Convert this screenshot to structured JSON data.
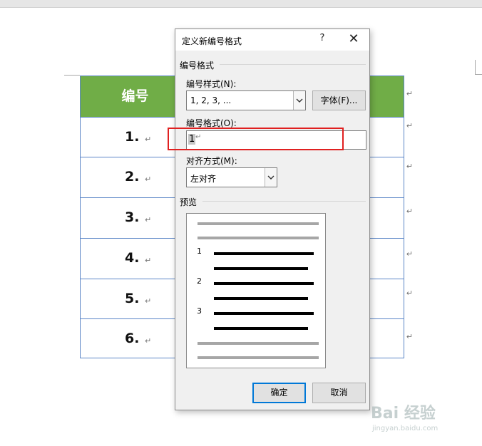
{
  "document": {
    "table_header": "编号",
    "rows": [
      "1.",
      "2.",
      "3.",
      "4.",
      "5.",
      "6."
    ],
    "paragraph_mark": "↵"
  },
  "dialog": {
    "title": "定义新编号格式",
    "help_label": "?",
    "close_label": "✕",
    "section_number_format": "编号格式",
    "number_style_label": "编号样式(N):",
    "number_style_value": "1, 2, 3, ...",
    "font_button": "字体(F)...",
    "number_format_label": "编号格式(O):",
    "number_format_value": "1",
    "alignment_label": "对齐方式(M):",
    "alignment_value": "左对齐",
    "section_preview": "预览",
    "preview_numbers": [
      "1",
      "2",
      "3"
    ],
    "ok_button": "确定",
    "cancel_button": "取消"
  },
  "watermark": {
    "brand": "Bai 经验",
    "url": "jingyan.baidu.com"
  },
  "colors": {
    "table_header_bg": "#70ad47",
    "table_border": "#5b86c7",
    "highlight": "#e02020",
    "default_button_border": "#0078d7"
  }
}
